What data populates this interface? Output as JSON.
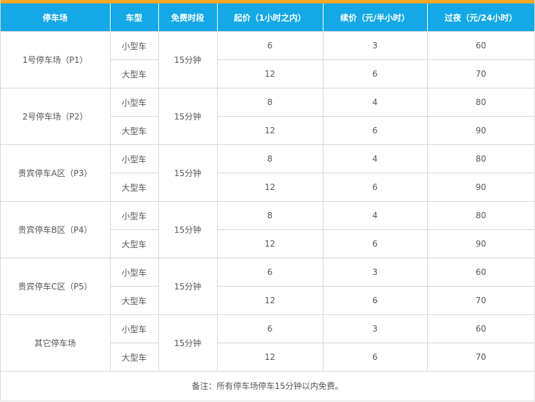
{
  "table": {
    "headers": [
      "停车场",
      "车型",
      "免费时段",
      "起价（1小时之内）",
      "续价（元/半小时）",
      "过夜（元/24小时）"
    ],
    "lots": [
      {
        "name": "1号停车场（P1）",
        "free_period": "15分钟",
        "rows": [
          {
            "type": "小型车",
            "start": "6",
            "continue": "3",
            "overnight": "60"
          },
          {
            "type": "大型车",
            "start": "12",
            "continue": "6",
            "overnight": "70"
          }
        ]
      },
      {
        "name": "2号停车场（P2）",
        "free_period": "15分钟",
        "rows": [
          {
            "type": "小型车",
            "start": "8",
            "continue": "4",
            "overnight": "80"
          },
          {
            "type": "大型车",
            "start": "12",
            "continue": "6",
            "overnight": "90"
          }
        ]
      },
      {
        "name": "贵宾停车A区（P3）",
        "free_period": "15分钟",
        "rows": [
          {
            "type": "小型车",
            "start": "8",
            "continue": "4",
            "overnight": "80"
          },
          {
            "type": "大型车",
            "start": "12",
            "continue": "6",
            "overnight": "90"
          }
        ]
      },
      {
        "name": "贵宾停车B区（P4）",
        "free_period": "15分钟",
        "rows": [
          {
            "type": "小型车",
            "start": "8",
            "continue": "4",
            "overnight": "80"
          },
          {
            "type": "大型车",
            "start": "12",
            "continue": "6",
            "overnight": "90"
          }
        ]
      },
      {
        "name": "贵宾停车C区（P5）",
        "free_period": "15分钟",
        "rows": [
          {
            "type": "小型车",
            "start": "6",
            "continue": "3",
            "overnight": "60"
          },
          {
            "type": "大型车",
            "start": "12",
            "continue": "6",
            "overnight": "70"
          }
        ]
      },
      {
        "name": "其它停车场",
        "free_period": "15分钟",
        "rows": [
          {
            "type": "小型车",
            "start": "6",
            "continue": "3",
            "overnight": "60"
          },
          {
            "type": "大型车",
            "start": "12",
            "continue": "6",
            "overnight": "70"
          }
        ]
      }
    ],
    "note": "备注：所有停车场停车15分钟以内免费。"
  },
  "colors": {
    "header_bg": "#14a8e6",
    "header_text": "#ffffff",
    "accent_bar": "#f5a623",
    "border": "#d6d6d6",
    "body_text": "#555555"
  }
}
